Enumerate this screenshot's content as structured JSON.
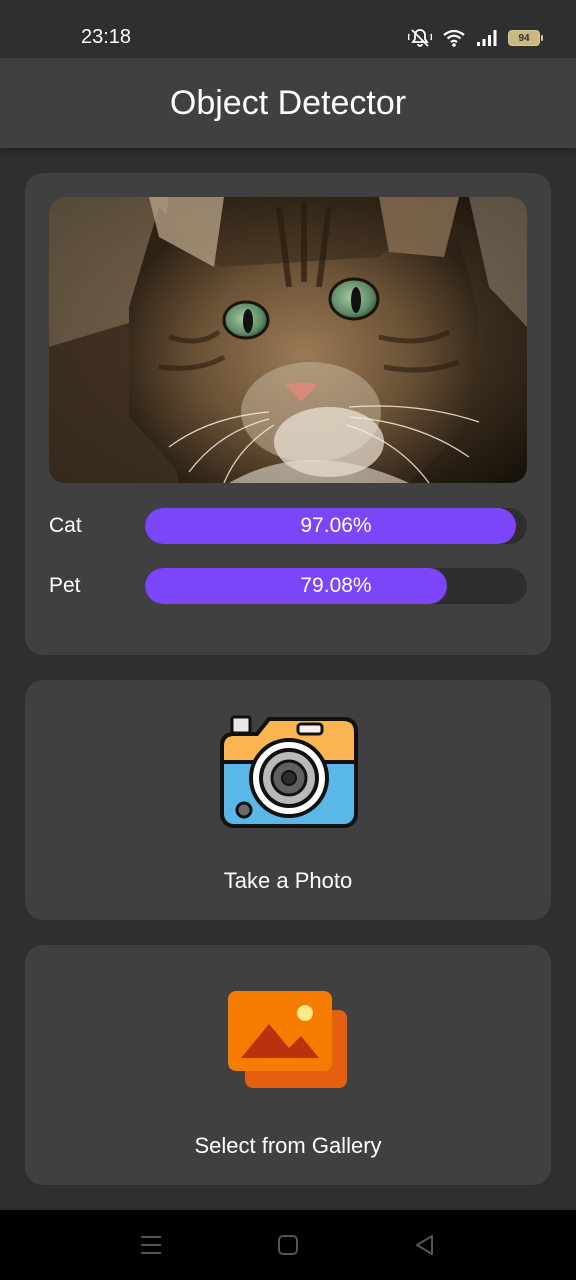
{
  "status_bar": {
    "time": "23:18",
    "battery": "94",
    "icons": [
      "mute-icon",
      "wifi-icon",
      "signal-icon",
      "battery-icon"
    ]
  },
  "app": {
    "title": "Object Detector"
  },
  "result": {
    "image": "cat-photo",
    "predictions": [
      {
        "label": "Cat",
        "percent": "97.06%",
        "value": 0.9706
      },
      {
        "label": "Pet",
        "percent": "79.08%",
        "value": 0.7908
      }
    ]
  },
  "actions": {
    "camera_label": "Take a Photo",
    "gallery_label": "Select from Gallery"
  },
  "colors": {
    "accent": "#7a46f8",
    "card": "#404040",
    "background": "#2f2f2f"
  }
}
